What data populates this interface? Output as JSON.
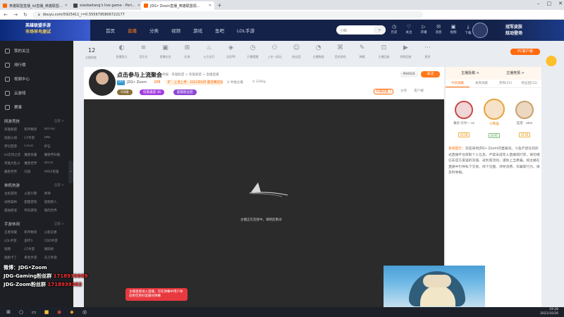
{
  "browser": {
    "tabs": [
      {
        "title": "英雄联盟直播_lol直播_英雄联盟..."
      },
      {
        "title": "xiaobaitang's live game - Peri..."
      },
      {
        "title": "JDG• Zoom直播_英雄联盟视..."
      }
    ],
    "url": "douyu.com/5925411_r=0.5556795806722177",
    "controls": {
      "minimize": "–",
      "maximize": "□",
      "close": "✕"
    }
  },
  "header": {
    "banner_line1": "英雄联盟手游",
    "banner_line2": "市场早鸟测试",
    "nav": [
      "首页",
      "直播",
      "分类",
      "视频",
      "游戏",
      "鱼吧",
      "LOL手游"
    ],
    "nav_active": 1,
    "search_placeholder": "小鲸",
    "icons": [
      {
        "icon": "history-icon",
        "label": "历史"
      },
      {
        "icon": "follow-icon",
        "label": "关注"
      },
      {
        "icon": "play-icon",
        "label": "开播"
      },
      {
        "icon": "message-icon",
        "label": "消息"
      },
      {
        "icon": "video-icon",
        "label": "视频"
      },
      {
        "icon": "download-icon",
        "label": "下载"
      }
    ],
    "promo_line1": "冠军皮肤",
    "promo_line2": "炫动登场"
  },
  "sidebar": {
    "items": [
      {
        "icon": "heart-icon",
        "label": "我的关注"
      },
      {
        "icon": "rank-icon",
        "label": "排行榜"
      },
      {
        "icon": "video-center-icon",
        "label": "视频中心"
      },
      {
        "icon": "cloud-icon",
        "label": "云游戏"
      },
      {
        "icon": "esports-icon",
        "label": "赛事"
      }
    ],
    "groups": [
      {
        "title": "网游竞技",
        "more": "全部 >",
        "items": [
          "英雄联盟",
          "和平精英",
          "DOTA2",
          "穿越火线",
          "CF手游",
          "DNF",
          "梦幻西游",
          "CSGO",
          "炉石",
          "lol云顶之弈",
          "魔兽争霸",
          "魔兽怀旧服",
          "英雄大乱斗",
          "魔兽世界",
          "DOTA",
          "魔兽世界",
          "问道",
          "APEX英雄"
        ]
      },
      {
        "title": "单机热游",
        "more": "全部 >",
        "items": [
          "主机游戏",
          "火箭引擎",
          "原神",
          "动物森林",
          "甜蜜游戏",
          "怪物猎人",
          "孤独摇滚",
          "怀旧游戏",
          "我的世界"
        ]
      },
      {
        "title": "手游休闲",
        "more": "全部 >",
        "items": [
          "王者荣耀",
          "和平精英",
          "火影忍者",
          "LOL手游",
          "崩坏3",
          "CDD手游",
          "暗网",
          "CF手游",
          "阴阳师",
          "跑跑卡丁",
          "拳皇手游",
          "天刀手游"
        ]
      }
    ]
  },
  "funcbar": {
    "follow_count": "12",
    "follow_label": "主播热度",
    "items": [
      {
        "icon": "fish-icon",
        "label": "直播鱼丸"
      },
      {
        "icon": "wave-icon",
        "label": "音乐台"
      },
      {
        "icon": "live-icon",
        "label": "直播任务"
      },
      {
        "icon": "gift-icon",
        "label": "礼物"
      },
      {
        "icon": "fire-icon",
        "label": "火力全开"
      },
      {
        "icon": "shield-icon",
        "label": "全民PK"
      },
      {
        "icon": "clock-icon",
        "label": "开播提醒"
      },
      {
        "icon": "game-icon",
        "label": "上车一起玩"
      },
      {
        "icon": "people-icon",
        "label": "粉丝团"
      },
      {
        "icon": "dashboard-icon",
        "label": "主播数据"
      },
      {
        "icon": "controller-icon",
        "label": "竞技游戏"
      },
      {
        "icon": "edit-icon",
        "label": "弹幕"
      },
      {
        "icon": "record-icon",
        "label": "主播回放"
      },
      {
        "icon": "camera-icon",
        "label": "视频回放"
      },
      {
        "icon": "more-icon",
        "label": "更多"
      }
    ],
    "pc_button": "PC客户端"
  },
  "room": {
    "title": "点击参与上流聚会",
    "categories": "举报 · 英雄联盟 > 英雄联盟 > 直播直播",
    "level": "LV5",
    "anchor": "JDG• Zoom",
    "hot": "288",
    "rank_text": "旷 · 上流上界 · 2021年6月 最佳赛冠军",
    "report": "♀ 举报主播",
    "weight": "♀ 130kg",
    "tags": [
      {
        "label": "VSI级",
        "color": "#8a6f3a"
      },
      {
        "label": "炫富通道  36",
        "color": "#a23de0"
      },
      {
        "label": "超能粉丝团  ",
        "color": "#8e45d6"
      }
    ],
    "badge": "开播提醒  2",
    "share": "分享",
    "client": "客户端",
    "fans": "994024",
    "follow_button": "关注"
  },
  "player": {
    "loading_text": "主播正在连接中，请稍后重试"
  },
  "rightpanel": {
    "title": "主播投稿 >",
    "subtitle": "主播竞猜 >",
    "tabs": [
      "今日贡献",
      "本周贡献",
      "贵宾(22)",
      "粉丝团(22)"
    ],
    "tab_active": 0,
    "ranks": [
      {
        "name": "桑达·贝尔··· sz",
        "level": "LV.38",
        "color": "#c94a4a"
      },
      {
        "name": "小熊猫",
        "level": "LV.41",
        "color": "#e7a23b"
      },
      {
        "name": "哇塔 · alex",
        "level": "LV.36",
        "color": "#caa070"
      }
    ],
    "notice_head": "系统提示：",
    "notice": "欢迎来到JDG• Zoom的直播间。斗鱼严禁任何形式直播平台获取个人信息，严禁未成年人直播或打赏，请勿相信非官方渠道的充值、返利等活动，谨防上当受骗。如主播在直播中引导私下交易、线下见面、诱导消费、诈骗等行为，请及时举报。"
  },
  "overlay": {
    "line1": "微博：JDG•Zoom",
    "line2a": "JDG-Gaming粉丝群  ",
    "line2b": "1718939099",
    "line3a": "JDG-Zoom粉丝群  ",
    "line3b": "1718939382"
  },
  "popup": {
    "text": "主播直接进入直播，可在弹幕中用户体验更佳更好直播间弹幕"
  },
  "taskbar": {
    "time": "19:28",
    "date": "2021/10/26"
  }
}
